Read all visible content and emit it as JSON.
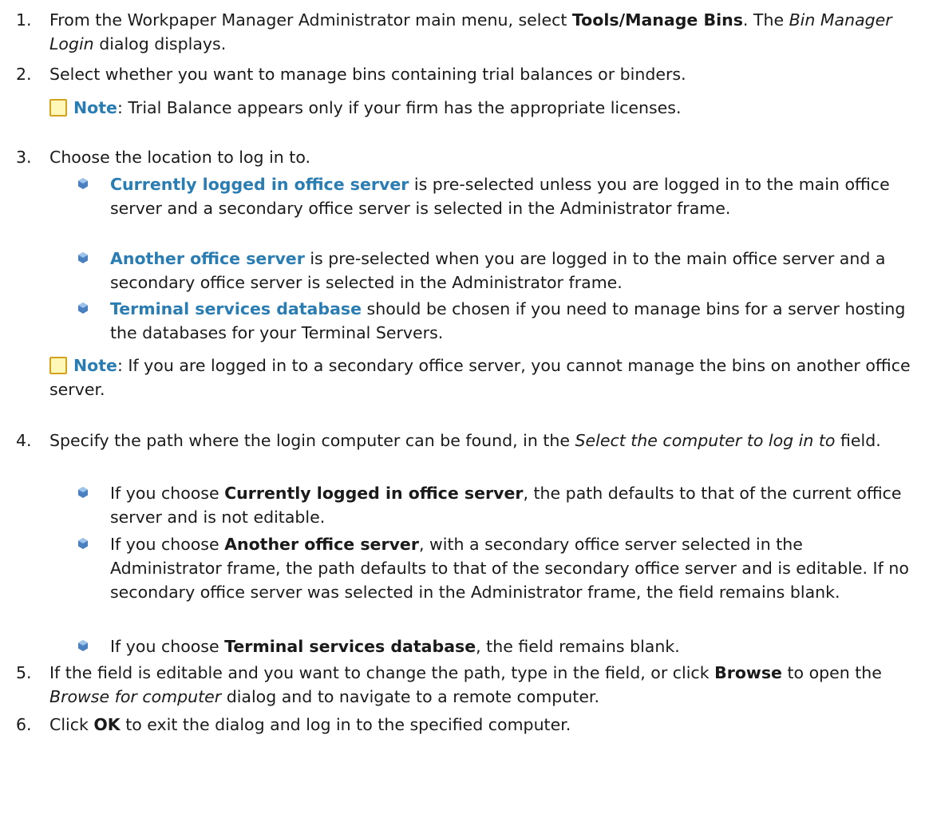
{
  "steps": [
    {
      "num": "1.",
      "t1": "From the Workpaper Manager Administrator main menu, select ",
      "b1": "Tools/Manage Bins",
      "t2": ". The ",
      "i1": "Bin Manager Login",
      "t3": " dialog displays."
    },
    {
      "num": "2.",
      "text": "Select whether you want to manage bins containing trial balances  or binders."
    },
    {
      "num": "3.",
      "text": "Choose the location to log in to."
    },
    {
      "num": "4.",
      "t1": "Specify the path where the login computer can be found, in the ",
      "i1": "Select the computer to log in to",
      "t2": " field."
    },
    {
      "num": "5.",
      "t1": "If the field is editable and you want to change the path, type in the field, or click ",
      "b1": "Browse",
      "t2": " to open the ",
      "i1": "Browse for computer",
      "t3": " dialog and to navigate to a remote computer."
    },
    {
      "num": "6.",
      "t1": "Click ",
      "b1": "OK",
      "t2": " to exit the dialog and log in to the specified computer."
    }
  ],
  "note1": {
    "label": "Note",
    "text": ": Trial Balance appears only if your firm has the appropriate licenses."
  },
  "note2": {
    "label": "Note",
    "text": ": If you are logged in to a secondary office server, you cannot manage the bins on another office server."
  },
  "step3_bullets": [
    {
      "term": "Currently logged in office server",
      "text": " is pre-selected unless you are logged in to the main office server and a secondary office server is selected in the Administrator frame."
    },
    {
      "term": "Another office server",
      "text": " is pre-selected when you are logged in to the main office server and a secondary office server is selected in the Administrator frame."
    },
    {
      "term": "Terminal services database",
      "text": " should be chosen if you need to manage bins for a server hosting the databases for your Terminal Servers."
    }
  ],
  "step4_bullets": [
    {
      "pre": "If you choose ",
      "term": "Currently logged in office server",
      "text": ", the path defaults to that of the current office server and is not editable."
    },
    {
      "pre": "If you choose ",
      "term": "Another office server",
      "text": ", with a secondary office server selected in the Administrator frame, the path defaults to that of the secondary office server and is editable. If no secondary office server was selected in the Administrator frame, the field remains blank."
    },
    {
      "pre": "If you choose ",
      "term": "Terminal services database",
      "text": ", the field remains blank."
    }
  ],
  "colors": {
    "link": "#2a7db2",
    "text": "#1a1a1a",
    "note_fill": "#fff7b8",
    "note_border": "#d4a21c",
    "bullet": "#4a7fc0"
  },
  "icons": {
    "note": "note-icon",
    "bullet": "bullet-icon"
  }
}
